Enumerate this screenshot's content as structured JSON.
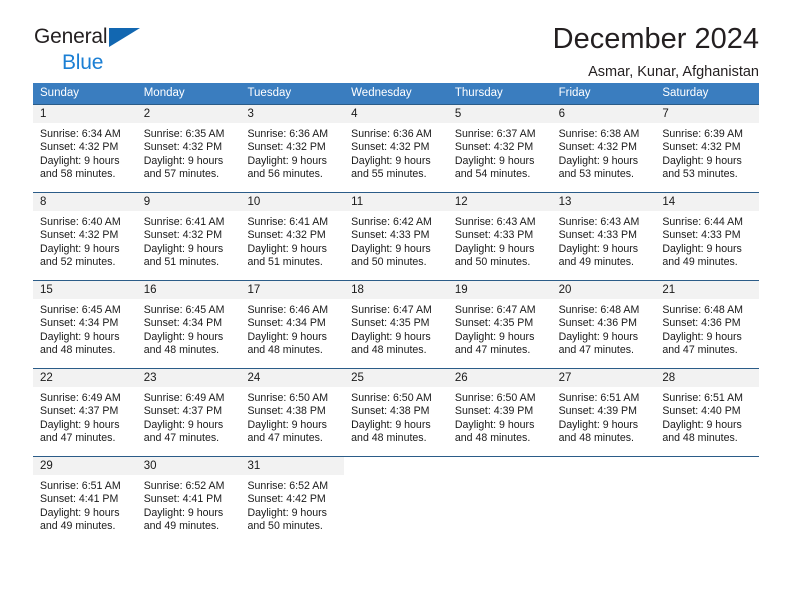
{
  "brand": {
    "line1": "General",
    "line2": "Blue",
    "triangle_color": "#1267b1",
    "line2_color": "#1b7fd4"
  },
  "header": {
    "title": "December 2024",
    "subtitle": "Asmar, Kunar, Afghanistan"
  },
  "theme": {
    "header_bg": "#3a7dbf",
    "header_text": "#ffffff",
    "week_divider": "#2b5c88",
    "day_band_bg": "#f2f2f2",
    "text": "#1a1a1a"
  },
  "weekdays": [
    "Sunday",
    "Monday",
    "Tuesday",
    "Wednesday",
    "Thursday",
    "Friday",
    "Saturday"
  ],
  "weeks": [
    [
      {
        "day": "1",
        "sunrise": "Sunrise: 6:34 AM",
        "sunset": "Sunset: 4:32 PM",
        "daylight1": "Daylight: 9 hours",
        "daylight2": "and 58 minutes."
      },
      {
        "day": "2",
        "sunrise": "Sunrise: 6:35 AM",
        "sunset": "Sunset: 4:32 PM",
        "daylight1": "Daylight: 9 hours",
        "daylight2": "and 57 minutes."
      },
      {
        "day": "3",
        "sunrise": "Sunrise: 6:36 AM",
        "sunset": "Sunset: 4:32 PM",
        "daylight1": "Daylight: 9 hours",
        "daylight2": "and 56 minutes."
      },
      {
        "day": "4",
        "sunrise": "Sunrise: 6:36 AM",
        "sunset": "Sunset: 4:32 PM",
        "daylight1": "Daylight: 9 hours",
        "daylight2": "and 55 minutes."
      },
      {
        "day": "5",
        "sunrise": "Sunrise: 6:37 AM",
        "sunset": "Sunset: 4:32 PM",
        "daylight1": "Daylight: 9 hours",
        "daylight2": "and 54 minutes."
      },
      {
        "day": "6",
        "sunrise": "Sunrise: 6:38 AM",
        "sunset": "Sunset: 4:32 PM",
        "daylight1": "Daylight: 9 hours",
        "daylight2": "and 53 minutes."
      },
      {
        "day": "7",
        "sunrise": "Sunrise: 6:39 AM",
        "sunset": "Sunset: 4:32 PM",
        "daylight1": "Daylight: 9 hours",
        "daylight2": "and 53 minutes."
      }
    ],
    [
      {
        "day": "8",
        "sunrise": "Sunrise: 6:40 AM",
        "sunset": "Sunset: 4:32 PM",
        "daylight1": "Daylight: 9 hours",
        "daylight2": "and 52 minutes."
      },
      {
        "day": "9",
        "sunrise": "Sunrise: 6:41 AM",
        "sunset": "Sunset: 4:32 PM",
        "daylight1": "Daylight: 9 hours",
        "daylight2": "and 51 minutes."
      },
      {
        "day": "10",
        "sunrise": "Sunrise: 6:41 AM",
        "sunset": "Sunset: 4:32 PM",
        "daylight1": "Daylight: 9 hours",
        "daylight2": "and 51 minutes."
      },
      {
        "day": "11",
        "sunrise": "Sunrise: 6:42 AM",
        "sunset": "Sunset: 4:33 PM",
        "daylight1": "Daylight: 9 hours",
        "daylight2": "and 50 minutes."
      },
      {
        "day": "12",
        "sunrise": "Sunrise: 6:43 AM",
        "sunset": "Sunset: 4:33 PM",
        "daylight1": "Daylight: 9 hours",
        "daylight2": "and 50 minutes."
      },
      {
        "day": "13",
        "sunrise": "Sunrise: 6:43 AM",
        "sunset": "Sunset: 4:33 PM",
        "daylight1": "Daylight: 9 hours",
        "daylight2": "and 49 minutes."
      },
      {
        "day": "14",
        "sunrise": "Sunrise: 6:44 AM",
        "sunset": "Sunset: 4:33 PM",
        "daylight1": "Daylight: 9 hours",
        "daylight2": "and 49 minutes."
      }
    ],
    [
      {
        "day": "15",
        "sunrise": "Sunrise: 6:45 AM",
        "sunset": "Sunset: 4:34 PM",
        "daylight1": "Daylight: 9 hours",
        "daylight2": "and 48 minutes."
      },
      {
        "day": "16",
        "sunrise": "Sunrise: 6:45 AM",
        "sunset": "Sunset: 4:34 PM",
        "daylight1": "Daylight: 9 hours",
        "daylight2": "and 48 minutes."
      },
      {
        "day": "17",
        "sunrise": "Sunrise: 6:46 AM",
        "sunset": "Sunset: 4:34 PM",
        "daylight1": "Daylight: 9 hours",
        "daylight2": "and 48 minutes."
      },
      {
        "day": "18",
        "sunrise": "Sunrise: 6:47 AM",
        "sunset": "Sunset: 4:35 PM",
        "daylight1": "Daylight: 9 hours",
        "daylight2": "and 48 minutes."
      },
      {
        "day": "19",
        "sunrise": "Sunrise: 6:47 AM",
        "sunset": "Sunset: 4:35 PM",
        "daylight1": "Daylight: 9 hours",
        "daylight2": "and 47 minutes."
      },
      {
        "day": "20",
        "sunrise": "Sunrise: 6:48 AM",
        "sunset": "Sunset: 4:36 PM",
        "daylight1": "Daylight: 9 hours",
        "daylight2": "and 47 minutes."
      },
      {
        "day": "21",
        "sunrise": "Sunrise: 6:48 AM",
        "sunset": "Sunset: 4:36 PM",
        "daylight1": "Daylight: 9 hours",
        "daylight2": "and 47 minutes."
      }
    ],
    [
      {
        "day": "22",
        "sunrise": "Sunrise: 6:49 AM",
        "sunset": "Sunset: 4:37 PM",
        "daylight1": "Daylight: 9 hours",
        "daylight2": "and 47 minutes."
      },
      {
        "day": "23",
        "sunrise": "Sunrise: 6:49 AM",
        "sunset": "Sunset: 4:37 PM",
        "daylight1": "Daylight: 9 hours",
        "daylight2": "and 47 minutes."
      },
      {
        "day": "24",
        "sunrise": "Sunrise: 6:50 AM",
        "sunset": "Sunset: 4:38 PM",
        "daylight1": "Daylight: 9 hours",
        "daylight2": "and 47 minutes."
      },
      {
        "day": "25",
        "sunrise": "Sunrise: 6:50 AM",
        "sunset": "Sunset: 4:38 PM",
        "daylight1": "Daylight: 9 hours",
        "daylight2": "and 48 minutes."
      },
      {
        "day": "26",
        "sunrise": "Sunrise: 6:50 AM",
        "sunset": "Sunset: 4:39 PM",
        "daylight1": "Daylight: 9 hours",
        "daylight2": "and 48 minutes."
      },
      {
        "day": "27",
        "sunrise": "Sunrise: 6:51 AM",
        "sunset": "Sunset: 4:39 PM",
        "daylight1": "Daylight: 9 hours",
        "daylight2": "and 48 minutes."
      },
      {
        "day": "28",
        "sunrise": "Sunrise: 6:51 AM",
        "sunset": "Sunset: 4:40 PM",
        "daylight1": "Daylight: 9 hours",
        "daylight2": "and 48 minutes."
      }
    ],
    [
      {
        "day": "29",
        "sunrise": "Sunrise: 6:51 AM",
        "sunset": "Sunset: 4:41 PM",
        "daylight1": "Daylight: 9 hours",
        "daylight2": "and 49 minutes."
      },
      {
        "day": "30",
        "sunrise": "Sunrise: 6:52 AM",
        "sunset": "Sunset: 4:41 PM",
        "daylight1": "Daylight: 9 hours",
        "daylight2": "and 49 minutes."
      },
      {
        "day": "31",
        "sunrise": "Sunrise: 6:52 AM",
        "sunset": "Sunset: 4:42 PM",
        "daylight1": "Daylight: 9 hours",
        "daylight2": "and 50 minutes."
      },
      {
        "day": "",
        "sunrise": "",
        "sunset": "",
        "daylight1": "",
        "daylight2": ""
      },
      {
        "day": "",
        "sunrise": "",
        "sunset": "",
        "daylight1": "",
        "daylight2": ""
      },
      {
        "day": "",
        "sunrise": "",
        "sunset": "",
        "daylight1": "",
        "daylight2": ""
      },
      {
        "day": "",
        "sunrise": "",
        "sunset": "",
        "daylight1": "",
        "daylight2": ""
      }
    ]
  ]
}
